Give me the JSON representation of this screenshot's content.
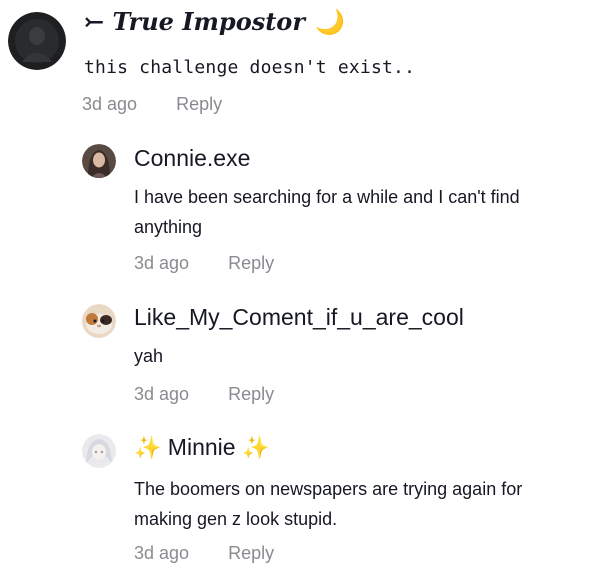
{
  "comments": [
    {
      "username_prefix": "⤚",
      "username": "True Impostor",
      "username_suffix": "🌙",
      "avatar_icon": "dark-portrait-avatar",
      "text": "this challenge doesn't exist..",
      "time": "3d ago",
      "reply_label": "Reply"
    },
    {
      "username": "Connie.exe",
      "avatar_icon": "girl-portrait-avatar",
      "text": "I have been searching for a while and I can't find anything",
      "time": "3d ago",
      "reply_label": "Reply"
    },
    {
      "username": "Like_My_Coment_if_u_are_cool",
      "avatar_icon": "guinea-pig-avatar",
      "text": "yah",
      "time": "3d ago",
      "reply_label": "Reply"
    },
    {
      "username_prefix": "✨",
      "username": "Minnie",
      "username_suffix": "✨",
      "avatar_icon": "anime-character-avatar",
      "text": "The boomers on newspapers are trying again for making gen z look stupid.",
      "time": "3d ago",
      "reply_label": "Reply"
    }
  ],
  "colors": {
    "text_primary": "#161823",
    "text_meta": "#8a8b91",
    "moon": "#f5b400",
    "sparkle": "#f4c20d"
  }
}
